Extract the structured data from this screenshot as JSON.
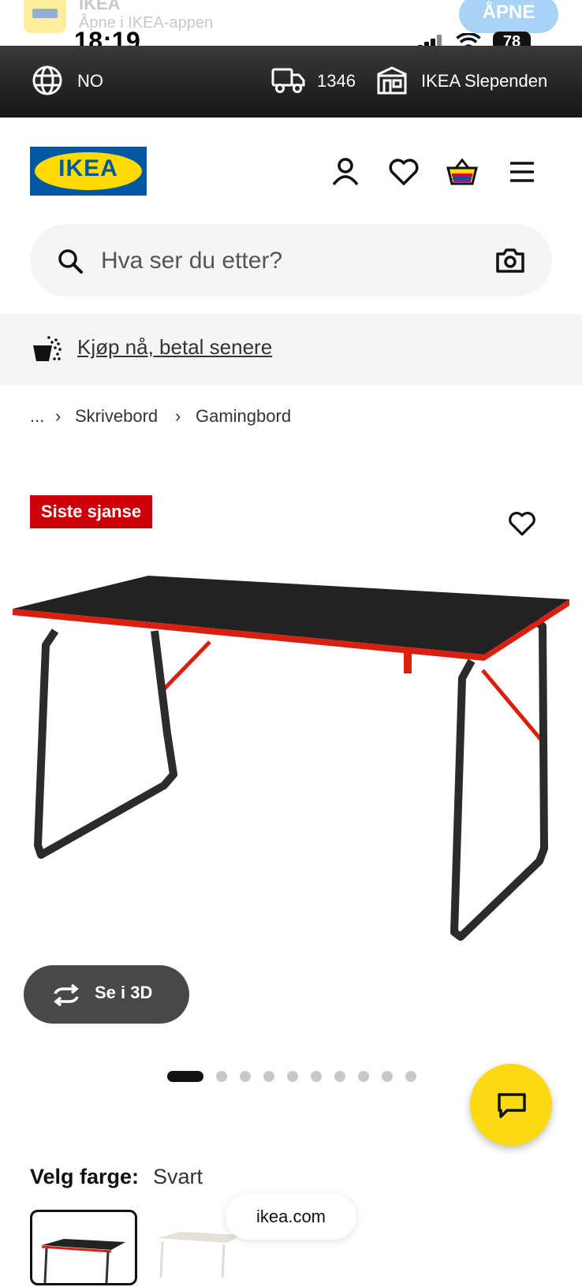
{
  "app_banner": {
    "name": "IKEA",
    "subtitle": "Åpne i IKEA-appen",
    "open_label": "ÅPNE"
  },
  "status_bar": {
    "time": "18:19",
    "battery": "78"
  },
  "top_bar": {
    "country": "NO",
    "postal_code": "1346",
    "store": "IKEA Slependen"
  },
  "header": {
    "logo_text": "IKEA"
  },
  "search": {
    "placeholder": "Hva ser du etter?"
  },
  "promo": {
    "label": "Kjøp nå, betal senere"
  },
  "breadcrumb": {
    "ellipsis": "...",
    "items": [
      "Skrivebord",
      "Gamingbord"
    ]
  },
  "product": {
    "badge": "Siste sjanse",
    "view_3d_label": "Se i 3D",
    "image_count": 10,
    "active_image": 1,
    "color_label": "Velg farge:",
    "color_value": "Svart"
  },
  "browser": {
    "url": "ikea.com"
  },
  "colors": {
    "ikea_blue": "#0058a3",
    "ikea_yellow": "#ffdb00",
    "badge_red": "#cc0008",
    "chat_yellow": "#fbd914"
  }
}
